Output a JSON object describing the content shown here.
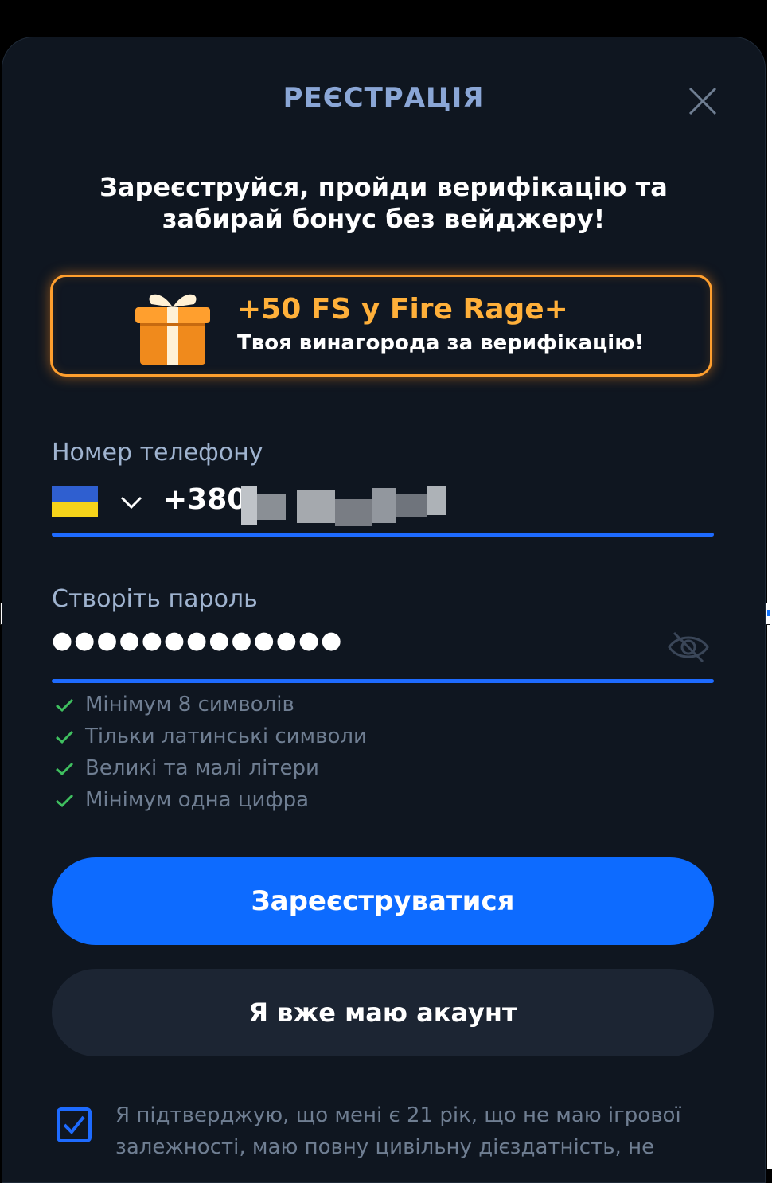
{
  "modal": {
    "title": "РЕЄСТРАЦІЯ",
    "close_icon": "close-icon",
    "subtitle": "Зареєструйся, пройди верифікацію та забирай бонус без вейджеру!"
  },
  "promo": {
    "icon": "gift-icon",
    "title": "+50 FS у Fire Rage+",
    "subtitle": "Твоя винагорода за верифікацію!"
  },
  "phone": {
    "label": "Номер телефону",
    "country_flag": "ukraine-flag-icon",
    "prefix": "+380"
  },
  "password": {
    "label": "Створіть пароль",
    "value": "●●●●●●●●●●●●●",
    "toggle_icon": "eye-off-icon",
    "rules": [
      "Мінімум 8 символів",
      "Тільки латинські символи",
      "Великі та малі літери",
      "Мінімум одна цифра"
    ]
  },
  "buttons": {
    "register": "Зареєструватися",
    "have_account": "Я вже маю акаунт"
  },
  "consent": {
    "checked": true,
    "text": "Я підтверджую, що мені є 21 рік, що не маю ігрової залежності, маю повну цивільну дієздатність, не"
  },
  "colors": {
    "background": "#0f1620",
    "accent": "#0d6bff",
    "promo_border": "#ff9f2e",
    "promo_title": "#ffb03a",
    "rule_check": "#3fbf5f"
  }
}
